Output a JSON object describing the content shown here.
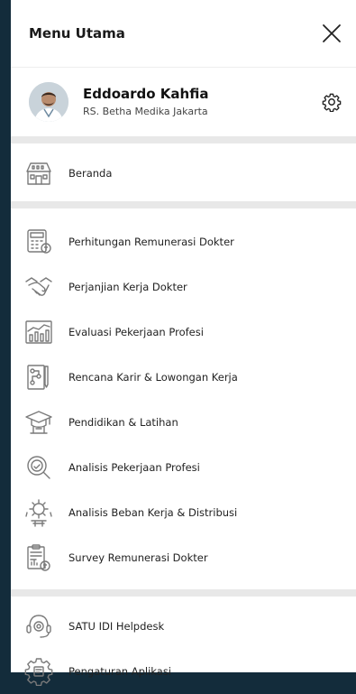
{
  "header": {
    "title": "Menu Utama"
  },
  "profile": {
    "name": "Eddoardo Kahfia",
    "hospital": "RS. Betha Medika Jakarta"
  },
  "menu_home": [
    {
      "label": "Beranda",
      "icon": "home-icon"
    }
  ],
  "menu_main": [
    {
      "label": "Perhitungan Remunerasi Dokter",
      "icon": "calculator-icon"
    },
    {
      "label": "Perjanjian Kerja Dokter",
      "icon": "handshake-icon"
    },
    {
      "label": "Evaluasi Pekerjaan Profesi",
      "icon": "bar-chart-icon"
    },
    {
      "label": "Rencana Karir & Lowongan Kerja",
      "icon": "career-plan-icon"
    },
    {
      "label": "Pendidikan & Latihan",
      "icon": "graduation-cap-icon"
    },
    {
      "label": "Analisis Pekerjaan Profesi",
      "icon": "magnifier-icon"
    },
    {
      "label": "Analisis Beban Kerja & Distribusi",
      "icon": "workload-icon"
    },
    {
      "label": "Survey Remunerasi Dokter",
      "icon": "survey-clipboard-icon"
    }
  ],
  "menu_bottom": [
    {
      "label": "SATU IDI Helpdesk",
      "icon": "headset-icon"
    },
    {
      "label": "Pengaturan Aplikasi",
      "icon": "app-settings-icon"
    }
  ],
  "colors": {
    "backdrop": "#132c3b",
    "divider": "#e8e8e8",
    "icon_stroke": "#7a7a7a"
  }
}
